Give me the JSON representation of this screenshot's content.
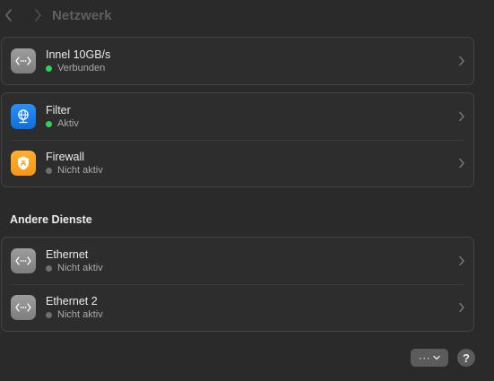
{
  "header": {
    "title": "Netzwerk"
  },
  "colors": {
    "status_active": "#30d158",
    "status_inactive": "#6e6e6e",
    "icon_gray": "#8e8e93",
    "icon_blue": "#1a7ff0",
    "icon_orange": "#fda324"
  },
  "groups": [
    {
      "items": [
        {
          "title": "Innel 10GB/s",
          "status": "Verbunden",
          "icon": "network-ellipsis-icon",
          "active": true
        }
      ]
    },
    {
      "items": [
        {
          "title": "Filter",
          "status": "Aktiv",
          "icon": "globe-icon",
          "active": true
        },
        {
          "title": "Firewall",
          "status": "Nicht aktiv",
          "icon": "shield-icon",
          "active": false
        }
      ]
    }
  ],
  "other_services": {
    "title": "Andere Dienste",
    "items": [
      {
        "title": "Ethernet",
        "status": "Nicht aktiv",
        "icon": "network-ellipsis-icon",
        "active": false
      },
      {
        "title": "Ethernet 2",
        "status": "Nicht aktiv",
        "icon": "network-ellipsis-icon",
        "active": false
      }
    ]
  },
  "footer": {
    "more_glyph": "···",
    "help_label": "?"
  }
}
